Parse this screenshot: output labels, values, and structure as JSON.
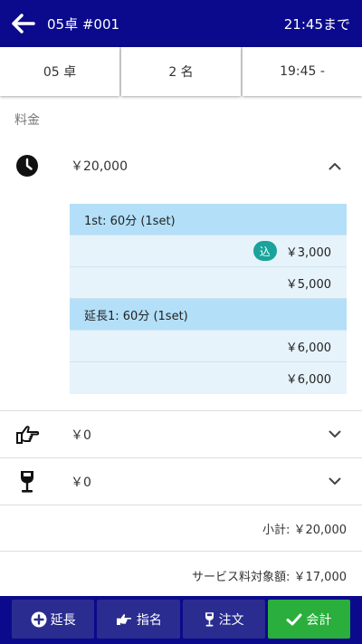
{
  "header": {
    "title": "05卓 #001",
    "until": "21:45まで"
  },
  "info": {
    "table": "05 卓",
    "guests": "2 名",
    "time": "19:45 -"
  },
  "section_label": "料金",
  "charge_rows": {
    "time": {
      "icon": "clock-icon",
      "amount": "￥20,000",
      "expanded": true
    },
    "nomination": {
      "icon": "pointing-hand-icon",
      "amount": "￥0",
      "expanded": false
    },
    "order": {
      "icon": "wine-glass-icon",
      "amount": "￥0",
      "expanded": false
    }
  },
  "time_detail": [
    {
      "header": "1st: 60分 (1set)",
      "rows": [
        {
          "badge": "込",
          "amount": "￥3,000"
        },
        {
          "badge": "",
          "amount": "￥5,000"
        }
      ]
    },
    {
      "header": "延長1: 60分 (1set)",
      "rows": [
        {
          "badge": "",
          "amount": "￥6,000"
        },
        {
          "badge": "",
          "amount": "￥6,000"
        }
      ]
    }
  ],
  "summary": {
    "subtotal": "小計: ￥20,000",
    "service_target": "サービス料対象額: ￥17,000"
  },
  "footer": {
    "extend": "延長",
    "nominate": "指名",
    "order": "注文",
    "checkout": "会計"
  },
  "colors": {
    "header_bg": "#0b0a8c",
    "detail_header": "#b3dff8",
    "detail_row": "#e6f3fb",
    "badge": "#1aa39a",
    "checkout": "#2aae3c"
  }
}
